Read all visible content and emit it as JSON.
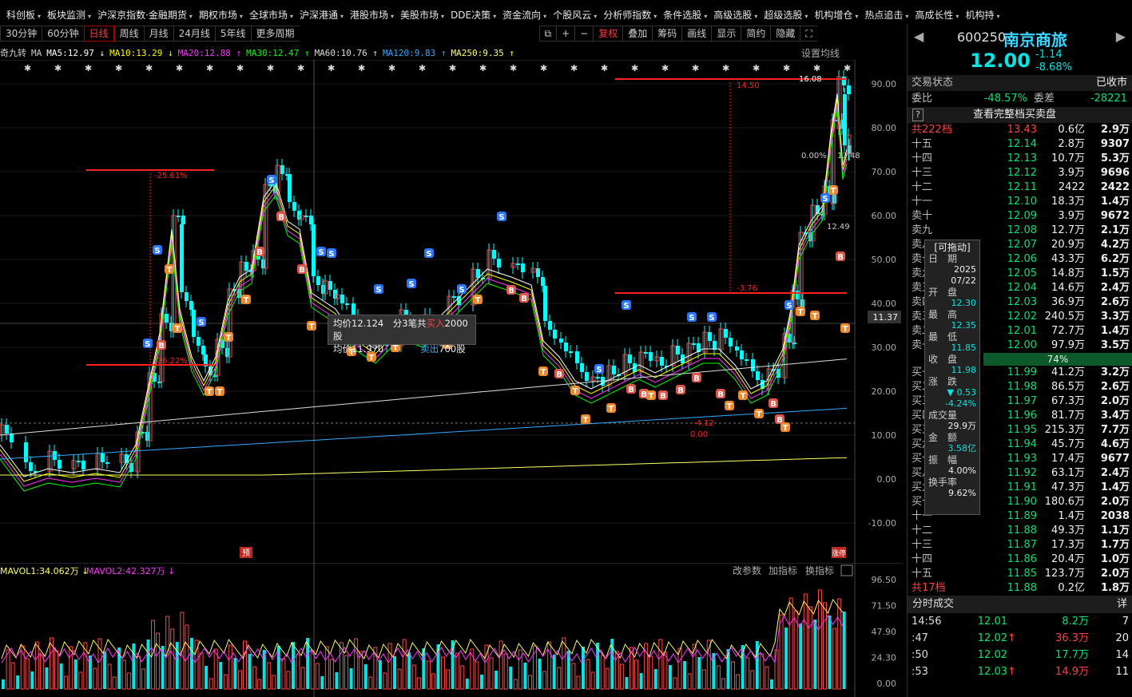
{
  "topnav": [
    "科创板",
    "板块监测",
    "沪深京指数·金融期货",
    "期权市场",
    "全球市场",
    "沪深港通",
    "港股市场",
    "美股市场",
    "DDE决策",
    "资金流向",
    "个股风云",
    "分析师指数",
    "条件选股",
    "高级选股",
    "超级选股",
    "机构增仓",
    "热点追击",
    "高成长性",
    "机构持"
  ],
  "toolbar": {
    "periods": [
      "30分钟",
      "60分钟",
      "日线",
      "周线",
      "月线",
      "24月线",
      "5年线",
      "更多周期"
    ],
    "active": "日线",
    "tools": [
      "复权",
      "叠加",
      "筹码",
      "画线",
      "显示",
      "简约",
      "隐藏"
    ]
  },
  "ma_line": {
    "prefix": "奇九转",
    "ma": "MA",
    "items": [
      {
        "t": "MA5:12.97 ↓",
        "c": "#ffffff"
      },
      {
        "t": "MA10:13.29 ↓",
        "c": "#ffff00"
      },
      {
        "t": "MA20:12.88 ↑",
        "c": "#ff33ff"
      },
      {
        "t": "MA30:12.47 ↑",
        "c": "#00ff00"
      },
      {
        "t": "MA60:10.76 ↑",
        "c": "#dddddd"
      },
      {
        "t": "MA120:9.83 ↑",
        "c": "#33aaff"
      },
      {
        "t": "MA250:9.35 ↑",
        "c": "#ffff66"
      }
    ],
    "setting": "设置均线"
  },
  "chart_data": {
    "type": "candlestick",
    "y_axis": [
      "90.00",
      "80.00",
      "70.00",
      "60.00",
      "50.00",
      "40.00",
      "30.00",
      "20.00",
      "10.00",
      "0.00",
      "-10.00"
    ],
    "cursor_value": "11.37",
    "annotations": [
      "16.08",
      "14.50",
      "-25.61%",
      "-26.22%",
      "-3.76",
      "-4.12",
      "0.00",
      "0.00%",
      "12.49",
      "13.48"
    ],
    "markers": {
      "pre": "预",
      "limit": "涨停"
    }
  },
  "tooltip": {
    "l1a": "均价12.124",
    "l1b": "分3笔共",
    "l1c": "买入",
    "l1d": "2000股",
    "l2a": "均价11.970",
    "l2c": "卖出",
    "l2d": "700股"
  },
  "vol": {
    "label1": "MAVOL1:34.062万 ↓",
    "label2": "MAVOL2:42.327万 ↓",
    "links": [
      "改参数",
      "加指标",
      "换指标"
    ],
    "y_axis": [
      "96.50",
      "71.50",
      "47.90",
      "24.30",
      "0.00"
    ]
  },
  "stock": {
    "code": "600250",
    "name": "南京商旅",
    "price": "12.00",
    "change": "-1.14",
    "pct": "-8.68%"
  },
  "status": {
    "label": "交易状态",
    "value": "已收市"
  },
  "weibi": {
    "label": "委比",
    "value": "-48.57%",
    "label2": "委差",
    "value2": "-28221"
  },
  "fullbook": "查看完整档买卖盘",
  "sell_total": {
    "label": "共222档",
    "price": "13.43",
    "amt": "0.6亿",
    "vol": "2.9万"
  },
  "asks": [
    [
      "十五",
      "12.14",
      "2.8万",
      "9307"
    ],
    [
      "十四",
      "12.13",
      "10.7万",
      "5.3万"
    ],
    [
      "十三",
      "12.12",
      "3.9万",
      "9696"
    ],
    [
      "十二",
      "12.11",
      "2422",
      "2422"
    ],
    [
      "十一",
      "12.10",
      "18.3万",
      "1.4万"
    ],
    [
      "卖十",
      "12.09",
      "3.9万",
      "9672"
    ],
    [
      "卖九",
      "12.08",
      "12.7万",
      "2.1万"
    ],
    [
      "卖八",
      "12.07",
      "20.9万",
      "4.2万"
    ],
    [
      "卖七",
      "12.06",
      "43.3万",
      "6.2万"
    ],
    [
      "卖六",
      "12.05",
      "14.8万",
      "1.5万"
    ],
    [
      "卖五",
      "12.04",
      "14.6万",
      "2.4万"
    ],
    [
      "卖四",
      "12.03",
      "36.9万",
      "2.6万"
    ],
    [
      "卖三",
      "12.02",
      "240.5万",
      "3.3万"
    ],
    [
      "卖二",
      "12.01",
      "72.7万",
      "1.4万"
    ],
    [
      "卖一",
      "12.00",
      "97.9万",
      "3.5万"
    ]
  ],
  "ratio": "74%",
  "bids": [
    [
      "买一",
      "11.99",
      "41.2万",
      "3.2万"
    ],
    [
      "买二",
      "11.98",
      "86.5万",
      "2.6万"
    ],
    [
      "买三",
      "11.97",
      "67.3万",
      "2.0万"
    ],
    [
      "买四",
      "11.96",
      "81.7万",
      "3.4万"
    ],
    [
      "买五",
      "11.95",
      "215.3万",
      "7.7万"
    ],
    [
      "买六",
      "11.94",
      "45.7万",
      "4.6万"
    ],
    [
      "买七",
      "11.93",
      "17.4万",
      "9677"
    ],
    [
      "买八",
      "11.92",
      "63.1万",
      "2.4万"
    ],
    [
      "买九",
      "11.91",
      "47.3万",
      "1.4万"
    ],
    [
      "买十",
      "11.90",
      "180.6万",
      "2.0万"
    ],
    [
      "十一",
      "11.89",
      "1.4万",
      "2038"
    ],
    [
      "十二",
      "11.88",
      "49.3万",
      "1.1万"
    ],
    [
      "十三",
      "11.87",
      "17.3万",
      "1.7万"
    ],
    [
      "十四",
      "11.86",
      "20.4万",
      "1.0万"
    ],
    [
      "十五",
      "11.85",
      "123.7万",
      "2.0万"
    ]
  ],
  "buy_total": {
    "label": "共17档",
    "price": "11.88",
    "amt": "0.2亿",
    "vol": "1.8万"
  },
  "ticks_title": "分时成交",
  "ticks_detail": "详",
  "ticks": [
    [
      "14:56",
      "12.01",
      "",
      "8.2万",
      "7"
    ],
    [
      ":47",
      "12.02",
      "↑",
      "36.3万",
      "20"
    ],
    [
      ":50",
      "12.02",
      "",
      "17.7万",
      "14"
    ],
    [
      ":53",
      "12.03",
      "↑",
      "14.9万",
      "11"
    ]
  ],
  "popup": {
    "title": "[可拖动]",
    "date_l": "日　期",
    "date_v1": "2025",
    "date_v2": "07/22",
    "open_l": "开　盘",
    "open_v": "12.30",
    "high_l": "最　高",
    "high_v": "12.35",
    "low_l": "最　低",
    "low_v": "11.85",
    "close_l": "收　盘",
    "close_v": "11.98",
    "chg_l": "涨　跌",
    "chg_v1": "▼ 0.53",
    "chg_v2": "-4.24%",
    "vol_l": "成交量",
    "vol_v": "29.9万",
    "amt_l": "金　额",
    "amt_v": "3.58亿",
    "amp_l": "振　幅",
    "amp_v": "4.00%",
    "turn_l": "换手率",
    "turn_v": "9.62%"
  }
}
